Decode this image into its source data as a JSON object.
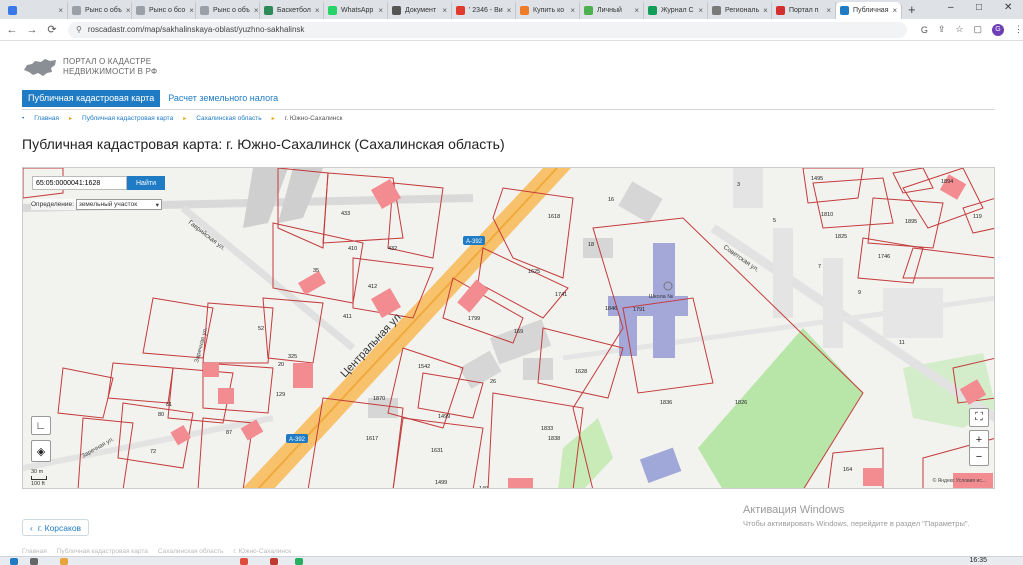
{
  "browser": {
    "tabs": [
      {
        "label": "",
        "color": "#3b78e7"
      },
      {
        "label": "Рынс о объ",
        "color": "#9aa0a6"
      },
      {
        "label": "Рынс о бсо",
        "color": "#9aa0a6"
      },
      {
        "label": "Рынс о объ",
        "color": "#9aa0a6"
      },
      {
        "label": "Баскетбол",
        "color": "#2e8b57"
      },
      {
        "label": "WhatsApp",
        "color": "#25d366"
      },
      {
        "label": "Документ",
        "color": "#555555"
      },
      {
        "label": "' 2346 - Ви",
        "color": "#e03a2f"
      },
      {
        "label": "Купить ко",
        "color": "#f07c2a"
      },
      {
        "label": "Личный",
        "color": "#4caf50"
      },
      {
        "label": "Журнал С",
        "color": "#0f9d58"
      },
      {
        "label": "Региональ",
        "color": "#7a7a7a"
      },
      {
        "label": "Портал п",
        "color": "#d32f2f"
      },
      {
        "label": "Публичная",
        "color": "#1f7bc4"
      }
    ],
    "new_tab": "+",
    "url": "roscadastr.com/map/sakhalinskaya-oblast/yuzhno-sakhalinsk",
    "profile_letter": "G",
    "controls": {
      "min": "–",
      "max": "□",
      "close": "✕"
    }
  },
  "site": {
    "logo_line1": "ПОРТАЛ О КАДАСТРЕ",
    "logo_line2": "НЕДВИЖИМОСТИ В РФ",
    "nav": {
      "active": "Публичная кадастровая карта",
      "link": "Расчет земельного налога"
    },
    "breadcrumbs": [
      "Главная",
      "Публичная кадастровая карта",
      "Сахалинская область",
      "г. Южно-Сахалинск"
    ],
    "title": "Публичная кадастровая карта: г. Южно-Сахалинск (Сахалинская область)",
    "back_label": "г. Корсаков",
    "footer_crumbs": [
      "Главная",
      "Публичная кадастровая карта",
      "Сахалинская область",
      "г. Южно-Сахалинск"
    ]
  },
  "map": {
    "search_value": "65:05:0000041:1628",
    "search_button": "Найти",
    "definition_label": "Определение:",
    "definition_value": "земельный участок",
    "street_main": "Центральная ул.",
    "street_gavr": "Гаврийская ул.",
    "street_sovet": "Советская ул.",
    "street_zarech": "Заречная ул.",
    "street_zarech2": "Заречная ул.",
    "road_label": "А-392",
    "road_label2": "А-392",
    "school_label": "Школа №",
    "scale_m": "30 m",
    "scale_ft": "100 ft",
    "copyright": "© Яндекс  Условия ис...",
    "zoom_in": "+",
    "zoom_out": "−",
    "parcels": [
      "1618",
      "1625",
      "1741",
      "1799",
      "169",
      "1628",
      "1542",
      "1833",
      "1838",
      "1826",
      "1836",
      "1631",
      "1617",
      "1870",
      "1499",
      "1810",
      "1825",
      "1746",
      "1895",
      "1894",
      "433",
      "410",
      "432",
      "412",
      "411",
      "35",
      "52",
      "325",
      "129",
      "1499",
      "1495",
      "1846",
      "1791",
      "72",
      "81",
      "80",
      "87",
      "16",
      "18",
      "26",
      "20",
      "3",
      "5",
      "7",
      "9",
      "11",
      "119",
      "149",
      "164"
    ]
  },
  "os": {
    "activation_title": "Активация Windows",
    "activation_text": "Чтобы активировать Windows, перейдите в раздел \"Параметры\".",
    "time": "16:35"
  }
}
